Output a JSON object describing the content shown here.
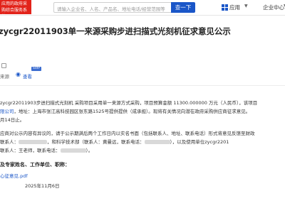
{
  "header": {
    "logo_text": "应用的政府采购综合服务系统",
    "search_placeholder": "请输入企业名、人名、产品名、地址电话/经营范围等",
    "search_button": "查一下",
    "app_menu_label": "应用",
    "enterprise_center_label": "企业中心"
  },
  "article": {
    "title": "zycgr22011903单一来源采购步进扫描式光刻机征求意见公示",
    "source_label": "来源",
    "view_label": "查看",
    "tag_label": "SVIP",
    "paragraphs": {
      "p1_line1": "zycgr22011903步进扫描式光刻机 采购项目采用单一来源方式采购，项目预算金额 11300.000000 万元（人民币），该项目",
      "p1_line2_link": "限公司",
      "p1_line2_rest": "，地址：上海市张江高科技园区张东路1525号提供提供（成承担）。现将有关情况向潜在政府采购供应商征求意见。",
      "p1_line3": "月14日止。",
      "p2_line1": "应商对公示内容有异议的，请于公示期满后两个工作日内以实名书面（包括联系人、地址、联系电话）形式将意见反馈至财政",
      "p2_line2": "联系人：",
      "p2_line2_mid": "，和科学技术部（联系人：黄曼远，联系电话：",
      "p2_line2_end": "），以及使用单位zycgr2201",
      "p2_line3": "联系人：王老师，联系电话：",
      "p2_line3_end": "）。"
    },
    "section_heading": "及专家姓名、工作单位、职称：",
    "attachment": "心征意见.pdf",
    "date": "2025年11月6日"
  }
}
